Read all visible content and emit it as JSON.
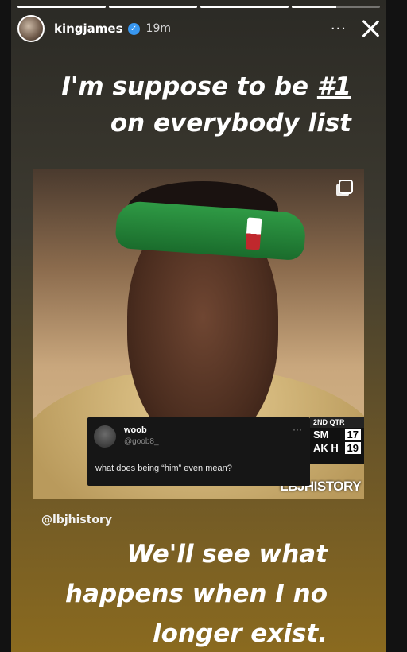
{
  "story": {
    "username": "kingjames",
    "time": "19m",
    "verified_icon": "verified-badge-icon",
    "progress": [
      1,
      1,
      1,
      0.5
    ],
    "headline": {
      "line1_prefix": "I'm suppose to be ",
      "line1_emph": "#1",
      "line2": "on everybody list"
    },
    "mention": "@lbjhistory",
    "caption": {
      "line1": "We'll see what",
      "line2": "happens when I no",
      "line3": "longer exist."
    }
  },
  "photo": {
    "watermark": "LBJHISTORY",
    "scoreboard": {
      "quarter": "2ND QTR",
      "team1": "SM",
      "score1": "17",
      "team2": "AK H",
      "score2": "19"
    }
  },
  "tweet": {
    "name": "woob",
    "handle": "@goob8_",
    "text": "what does being “him” even mean?",
    "more": "···"
  },
  "controls": {
    "more": "···"
  }
}
